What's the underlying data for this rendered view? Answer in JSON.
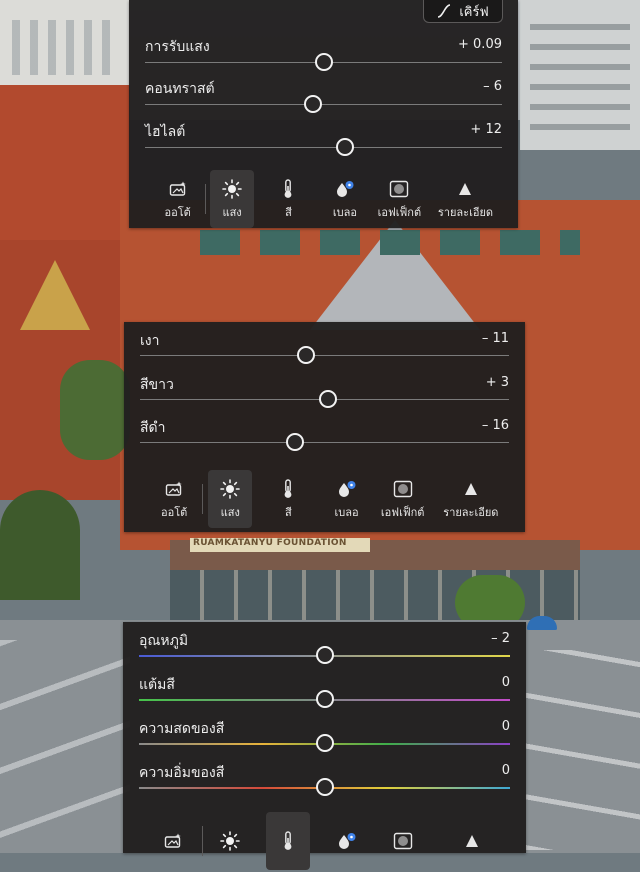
{
  "curve_button": {
    "label": "เคิร์ฟ",
    "icon": "curve-icon"
  },
  "light_panel_top": {
    "sliders": [
      {
        "label": "การรับแสง",
        "value": "+ 0.09",
        "position": 0.5
      },
      {
        "label": "คอนทราสต์",
        "value": "– 6",
        "position": 0.47
      },
      {
        "label": "ไฮไลต์",
        "value": "+ 12",
        "position": 0.56
      }
    ]
  },
  "light_panel_middle": {
    "sliders": [
      {
        "label": "เงา",
        "value": "– 11",
        "position": 0.45
      },
      {
        "label": "สีขาว",
        "value": "+ 3",
        "position": 0.51
      },
      {
        "label": "สีดำ",
        "value": "– 16",
        "position": 0.42
      }
    ]
  },
  "color_panel": {
    "sliders": [
      {
        "label": "อุณหภูมิ",
        "value": "– 2",
        "position": 0.5
      },
      {
        "label": "แต้มสี",
        "value": "0",
        "position": 0.5
      },
      {
        "label": "ความสดของสี",
        "value": "0",
        "position": 0.5
      },
      {
        "label": "ความอิ่มของสี",
        "value": "0",
        "position": 0.5
      }
    ]
  },
  "toolbar": [
    {
      "label": "ออโต้",
      "icon": "auto-enhance-icon"
    },
    {
      "label": "แสง",
      "icon": "sun-icon"
    },
    {
      "label": "สี",
      "icon": "thermometer-icon"
    },
    {
      "label": "เบลอ",
      "icon": "drop-blur-icon"
    },
    {
      "label": "เอฟเฟ็กต์",
      "icon": "vignette-icon"
    },
    {
      "label": "รายละเอียด",
      "icon": "triangle-icon"
    }
  ],
  "background": {
    "sign_text": "RUAMKATANYU FOUNDATION"
  },
  "colors": {
    "panel": "#211f1f",
    "active_tool": "#3a3838",
    "text": "#eeeeee"
  }
}
